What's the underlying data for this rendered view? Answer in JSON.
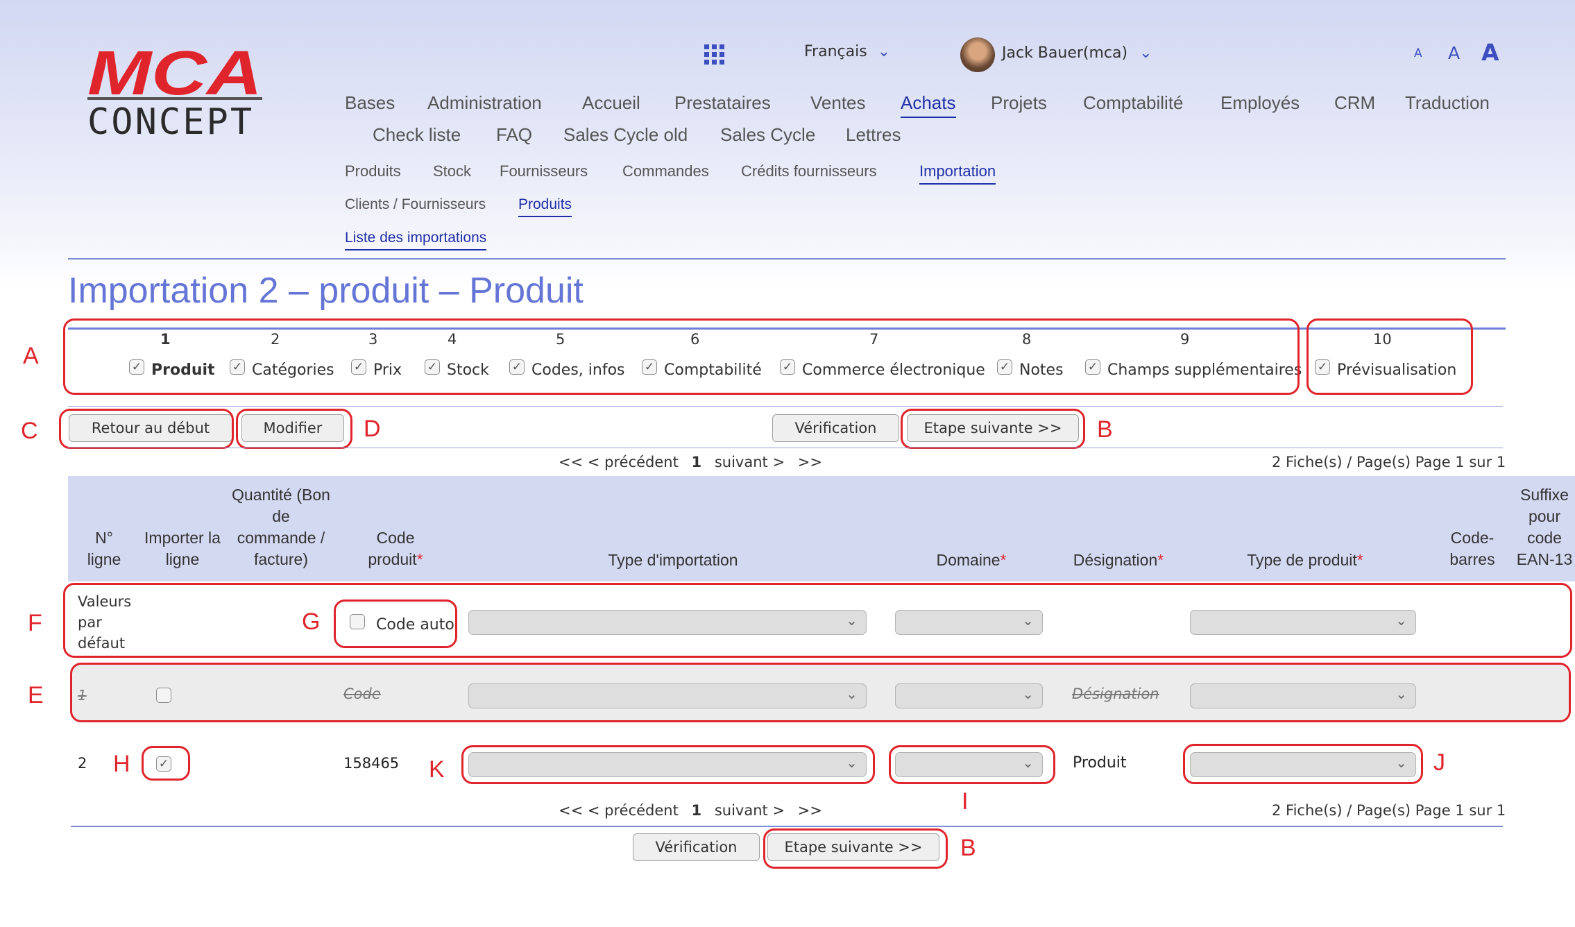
{
  "logo": {
    "top": "MCA",
    "bottom": "CONCEPT"
  },
  "header": {
    "language": "Français",
    "user": "Jack Bauer",
    "user_login": "(mca)",
    "font_sizes": [
      "A",
      "A",
      "A"
    ]
  },
  "nav": {
    "main": [
      "Bases",
      "Administration",
      "Accueil",
      "Prestataires",
      "Ventes",
      "Achats",
      "Projets",
      "Comptabilité",
      "Employés",
      "CRM",
      "Traduction"
    ],
    "main2": [
      "Check liste",
      "FAQ",
      "Sales Cycle old",
      "Sales Cycle",
      "Lettres"
    ],
    "sub": [
      "Produits",
      "Stock",
      "Fournisseurs",
      "Commandes",
      "Crédits fournisseurs",
      "Importation"
    ],
    "sub2": [
      "Clients / Fournisseurs",
      "Produits"
    ],
    "sub3": [
      "Liste des importations"
    ]
  },
  "page_title": "Importation 2 – produit – Produit",
  "steps": [
    {
      "num": "1",
      "label": "Produit"
    },
    {
      "num": "2",
      "label": "Catégories"
    },
    {
      "num": "3",
      "label": "Prix"
    },
    {
      "num": "4",
      "label": "Stock"
    },
    {
      "num": "5",
      "label": "Codes, infos"
    },
    {
      "num": "6",
      "label": "Comptabilité"
    },
    {
      "num": "7",
      "label": "Commerce électronique"
    },
    {
      "num": "8",
      "label": "Notes"
    },
    {
      "num": "9",
      "label": "Champs supplémentaires"
    },
    {
      "num": "10",
      "label": "Prévisualisation"
    }
  ],
  "buttons": {
    "back": "Retour au début",
    "modify": "Modifier",
    "verify": "Vérification",
    "next": "Etape suivante >>"
  },
  "pager": {
    "first": "<<",
    "prev": "< précédent",
    "current": "1",
    "next": "suivant >",
    "last": ">>",
    "info": "2 Fiche(s) / Page(s) Page 1 sur 1"
  },
  "table": {
    "headers": {
      "line_no": "N° ligne",
      "import": "Importer la ligne",
      "quantity": "Quantité (Bon de commande / facture)",
      "code": "Code produit",
      "type_import": "Type d'importation",
      "domain": "Domaine",
      "designation": "Désignation",
      "product_type": "Type de produit",
      "barcode": "Code-barres",
      "suffix": "Suffixe pour code EAN-13"
    },
    "required_mark": "*",
    "defaults": {
      "label": "Valeurs par défaut",
      "code_auto": "Code auto"
    },
    "rows": [
      {
        "no": "1",
        "code": "Code",
        "designation": "Désignation",
        "checked": false
      },
      {
        "no": "2",
        "code": "158465",
        "designation": "Produit",
        "checked": true
      }
    ]
  },
  "annotations": {
    "A": "A",
    "B": "B",
    "C": "C",
    "D": "D",
    "E": "E",
    "F": "F",
    "G": "G",
    "H": "H",
    "I": "I",
    "J": "J",
    "K": "K"
  },
  "colors": {
    "accent": "#1f2ea8",
    "title": "#6475d6",
    "annotation": "#e0242b",
    "table_header_bg": "#d4d9f2"
  }
}
